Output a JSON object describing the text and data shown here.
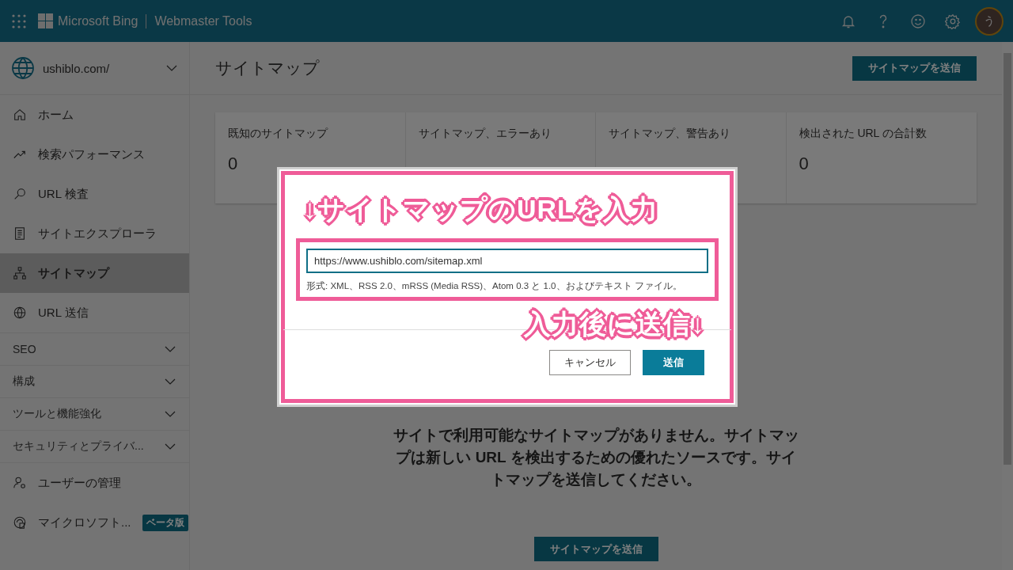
{
  "header": {
    "brand": "Microsoft Bing",
    "product": "Webmaster Tools",
    "avatar": "う"
  },
  "sidebar": {
    "site": "ushiblo.com/",
    "nav": [
      {
        "label": "ホーム",
        "selected": false
      },
      {
        "label": "検索パフォーマンス",
        "selected": false
      },
      {
        "label": "URL 検査",
        "selected": false
      },
      {
        "label": "サイトエクスプローラ",
        "selected": false
      },
      {
        "label": "サイトマップ",
        "selected": true
      },
      {
        "label": "URL 送信",
        "selected": false
      }
    ],
    "sections": [
      {
        "label": "SEO",
        "expanded": false
      },
      {
        "label": "構成",
        "expanded": false
      },
      {
        "label": "ツールと機能強化",
        "expanded": false
      },
      {
        "label": "セキュリティとプライバ...",
        "expanded": false
      }
    ],
    "bottom": [
      {
        "label": "ユーザーの管理"
      },
      {
        "label": "マイクロソフト...",
        "badge": "ベータ版"
      }
    ]
  },
  "main": {
    "title": "サイトマップ",
    "submit_button": "サイトマップを送信",
    "cards": [
      {
        "label": "既知のサイトマップ",
        "value": "0"
      },
      {
        "label": "サイトマップ、エラーあり"
      },
      {
        "label": "サイトマップ、警告あり"
      },
      {
        "label": "検出された URL の合計数",
        "value": "0"
      }
    ],
    "empty_message": "サイトで利用可能なサイトマップがありません。サイトマップは新しい URL を検出するための優れたソースです。サイトマップを送信してください。",
    "bottom_button": "サイトマップを送信"
  },
  "dialog": {
    "url_value": "https://www.ushiblo.com/sitemap.xml",
    "help": "形式: XML、RSS 2.0、mRSS (Media RSS)、Atom 0.3 と 1.0、およびテキスト ファイル。",
    "cancel": "キャンセル",
    "submit": "送信"
  },
  "annotations": [
    {
      "text": "↓サイトマップのURLを入力"
    },
    {
      "text": "入力後に送信↓"
    }
  ]
}
